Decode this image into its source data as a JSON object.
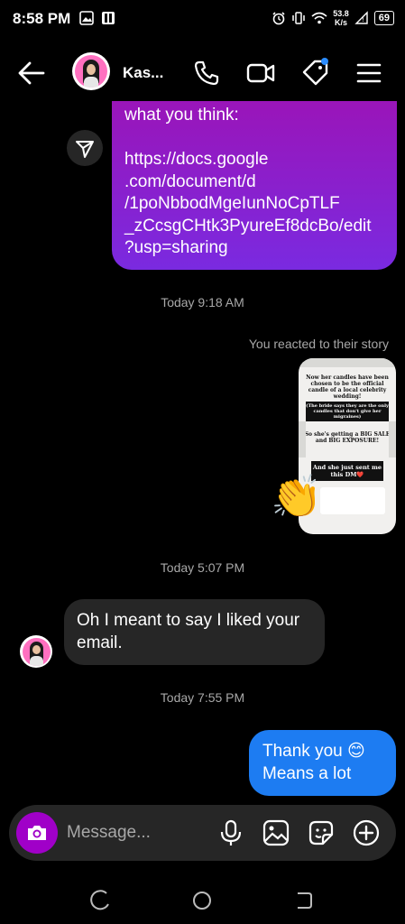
{
  "status_bar": {
    "time": "8:58 PM",
    "net_speed_value": "53.8",
    "net_speed_unit": "K/s",
    "battery": "69"
  },
  "header": {
    "contact_name": "Kas..."
  },
  "messages": {
    "link_message_lines": [
      "what you think:",
      "",
      "https://docs.google",
      ".com/document/d",
      "/1poNbbodMgeIunNoCpTLF",
      "_zCcsgCHtk3PyureEf8dcBo/edit",
      "?usp=sharing"
    ],
    "timestamp_1": "Today 9:18 AM",
    "reaction_note": "You reacted to their story",
    "story": {
      "line1": "Now her candles have been chosen to be the official candle of a local celebrity wedding!",
      "line2": "(The bride says they are the only candles that don't give her migraines)",
      "line3": "So she's getting a BIG SALE and BIG EXPOSURE!",
      "line4": "And she just sent me this DM❤️"
    },
    "reaction_emoji": "👏",
    "timestamp_2": "Today 5:07 PM",
    "incoming_text_line1": "Oh I meant to say I liked your",
    "incoming_text_line2": "email.",
    "timestamp_3": "Today 7:55 PM",
    "outgoing_text_line1": "Thank you 😊",
    "outgoing_text_line2": "Means a lot"
  },
  "composer": {
    "placeholder": "Message..."
  },
  "colors": {
    "purple_bubble_top": "#9a15b9",
    "purple_bubble_bottom": "#7a2ae0",
    "blue_bubble": "#1d7cf2",
    "gray_bubble": "#262626",
    "camera_button": "#a000c8"
  }
}
